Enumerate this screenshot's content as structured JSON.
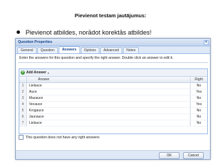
{
  "slide": {
    "title": "Pievienot testam  jautājumus:",
    "bullet": "Pievienot atbildes, norādot korektās atbildes!"
  },
  "dialog": {
    "title": "Question Properties",
    "close_symbol": "×",
    "tabs": [
      "General",
      "Question",
      "Answers",
      "Options",
      "Advanced",
      "Notes"
    ],
    "active_tab": "Answers",
    "instructions": "Enter the answers for this question and specify the right answer. Double click an answer to edit it.",
    "toolbar": {
      "add_answer_label": "Add Answer",
      "add_icon_symbol": "+",
      "dropdown_symbol": "▾"
    },
    "grid": {
      "columns": {
        "answer": "Answer",
        "right": "Right"
      },
      "rows": [
        {
          "num": "1",
          "answer": "Lielauce",
          "right": "No"
        },
        {
          "num": "2",
          "answer": "Auce",
          "right": "Yes"
        },
        {
          "num": "3",
          "answer": "Mazauce",
          "right": "No"
        },
        {
          "num": "4",
          "answer": "Vecauce",
          "right": "Yes"
        },
        {
          "num": "5",
          "answer": "Krogauce",
          "right": "No"
        },
        {
          "num": "6",
          "answer": "Jaunauce",
          "right": "No"
        },
        {
          "num": "7",
          "answer": "Lielauce",
          "right": "No"
        }
      ]
    },
    "checkbox_label": "This question does not have any right answers",
    "buttons": {
      "ok": "OK",
      "cancel": "Cancel"
    }
  },
  "colors": {
    "accent": "#15428b",
    "header_bg": "#dfe8f6",
    "border": "#99bbe8"
  },
  "icons": {
    "add": "add-icon",
    "close": "close-icon"
  }
}
